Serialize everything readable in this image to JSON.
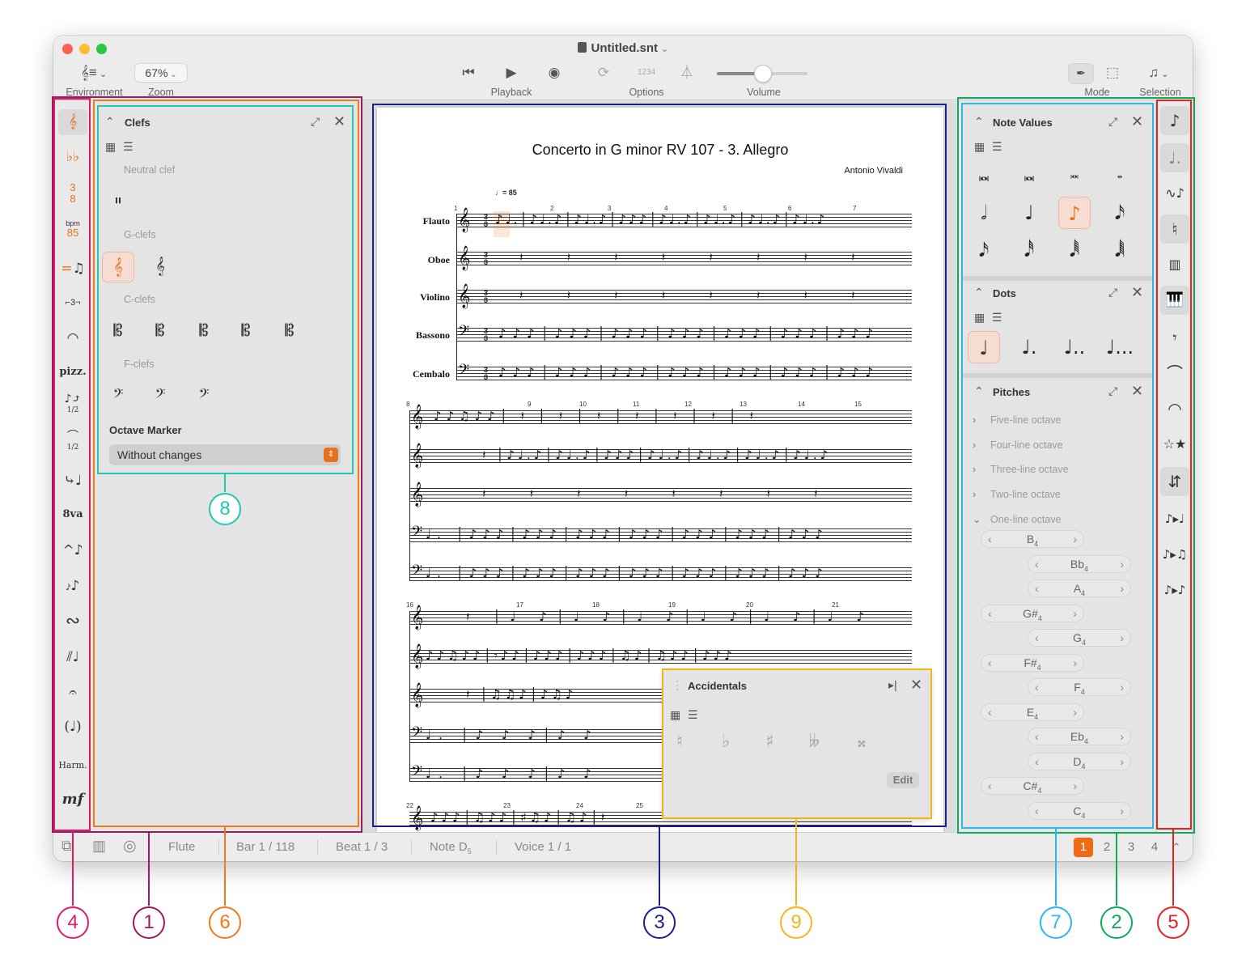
{
  "window": {
    "title": "Untitled.snt"
  },
  "toolbar": {
    "environment_label": "Environment",
    "zoom_label": "Zoom",
    "zoom_value": "67%",
    "playback_label": "Playback",
    "options_label": "Options",
    "options_counter": "1234",
    "volume_label": "Volume",
    "volume_level": 0.5,
    "mode_label": "Mode",
    "selection_label": "Selection"
  },
  "left_strip": {
    "time_sig_top": "3",
    "time_sig_bottom": "8",
    "bpm_label": "bpm",
    "bpm_value": "85",
    "tuplet_label": "3",
    "pizz_label": "pizz.",
    "half_label_1": "1/2",
    "half_label_2": "1/2",
    "ottava_label": "8va",
    "harm_label": "Harm.",
    "dynamic_label": "mf"
  },
  "clefs_panel": {
    "title": "Clefs",
    "neutral_label": "Neutral clef",
    "g_label": "G-clefs",
    "c_label": "C-clefs",
    "f_label": "F-clefs",
    "octave_marker_label": "Octave Marker",
    "octave_marker_value": "Without changes"
  },
  "score": {
    "title": "Concerto in G minor RV 107 - 3. Allegro",
    "composer": "Antonio Vivaldi",
    "tempo_mark": "= 85",
    "time_sig_top": "3",
    "time_sig_bottom": "8",
    "instruments": [
      "Flauto",
      "Oboe",
      "Violino",
      "Bassono",
      "Cembalo"
    ],
    "bar_numbers_sys1": [
      "1",
      "2",
      "3",
      "4",
      "5",
      "6",
      "7"
    ],
    "bar_numbers_sys2": [
      "8",
      "9",
      "10",
      "11",
      "12",
      "13",
      "14",
      "15"
    ],
    "bar_numbers_sys3": [
      "16",
      "17",
      "18",
      "19",
      "20",
      "21"
    ],
    "bar_numbers_sys4": [
      "22",
      "23",
      "24",
      "25"
    ]
  },
  "note_values_panel": {
    "title": "Note Values"
  },
  "dots_panel": {
    "title": "Dots"
  },
  "pitches_panel": {
    "title": "Pitches",
    "octaves": [
      "Five-line octave",
      "Four-line octave",
      "Three-line octave",
      "Two-line octave",
      "One-line octave"
    ],
    "pitches": [
      {
        "name": "B",
        "sub": "4",
        "offset": "left"
      },
      {
        "name": "Bb",
        "sub": "4",
        "offset": "right"
      },
      {
        "name": "A",
        "sub": "4",
        "offset": "right"
      },
      {
        "name": "G#",
        "sub": "4",
        "offset": "left"
      },
      {
        "name": "G",
        "sub": "4",
        "offset": "right"
      },
      {
        "name": "F#",
        "sub": "4",
        "offset": "left"
      },
      {
        "name": "F",
        "sub": "4",
        "offset": "right"
      },
      {
        "name": "E",
        "sub": "4",
        "offset": "left"
      },
      {
        "name": "Eb",
        "sub": "4",
        "offset": "right"
      },
      {
        "name": "D",
        "sub": "4",
        "offset": "right"
      },
      {
        "name": "C#",
        "sub": "4",
        "offset": "left"
      },
      {
        "name": "C",
        "sub": "4",
        "offset": "right"
      }
    ]
  },
  "accidentals_panel": {
    "title": "Accidentals",
    "edit_label": "Edit"
  },
  "statusbar": {
    "instrument": "Flute",
    "bar": "Bar 1 / 118",
    "beat": "Beat 1 / 3",
    "note": "Note D",
    "note_sub": "5",
    "voice": "Voice 1 / 1",
    "pages": [
      "1",
      "2",
      "3",
      "4"
    ],
    "current_page": "1"
  },
  "annotations": {
    "colors": {
      "a1": "#9c1a5e",
      "a2": "#13a85a",
      "a3": "#1f1f8c",
      "a4": "#e01a6a",
      "a5": "#e52121",
      "a6": "#f07a1a",
      "a7": "#2bb7ee",
      "a8": "#1fc9b0",
      "a9": "#f2b51c"
    },
    "labels": [
      "4",
      "1",
      "6",
      "3",
      "9",
      "7",
      "2",
      "5",
      "8"
    ]
  }
}
